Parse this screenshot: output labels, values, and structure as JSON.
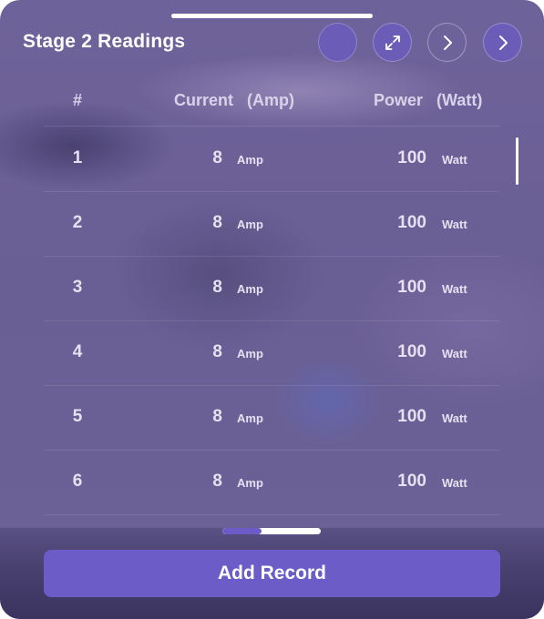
{
  "header": {
    "title": "Stage 2 Readings",
    "buttons": {
      "circle_icon": "circle-icon",
      "expand_icon": "expand-icon",
      "next_icon": "chevron-right-icon"
    }
  },
  "table": {
    "columns": {
      "index": "#",
      "current": "Current",
      "current_unit": "(Amp)",
      "power": "Power",
      "power_unit": "(Watt)"
    },
    "rows": [
      {
        "index": "1",
        "current": "8",
        "current_unit": "Amp",
        "power": "100",
        "power_unit": "Watt"
      },
      {
        "index": "2",
        "current": "8",
        "current_unit": "Amp",
        "power": "100",
        "power_unit": "Watt"
      },
      {
        "index": "3",
        "current": "8",
        "current_unit": "Amp",
        "power": "100",
        "power_unit": "Watt"
      },
      {
        "index": "4",
        "current": "8",
        "current_unit": "Amp",
        "power": "100",
        "power_unit": "Watt"
      },
      {
        "index": "5",
        "current": "8",
        "current_unit": "Amp",
        "power": "100",
        "power_unit": "Watt"
      },
      {
        "index": "6",
        "current": "8",
        "current_unit": "Amp",
        "power": "100",
        "power_unit": "Watt"
      }
    ]
  },
  "scroll": {
    "horizontal_fraction": 0.4
  },
  "footer": {
    "add_label": "Add Record"
  },
  "colors": {
    "accent": "#6b5cc8",
    "panel": "#6b6196"
  }
}
